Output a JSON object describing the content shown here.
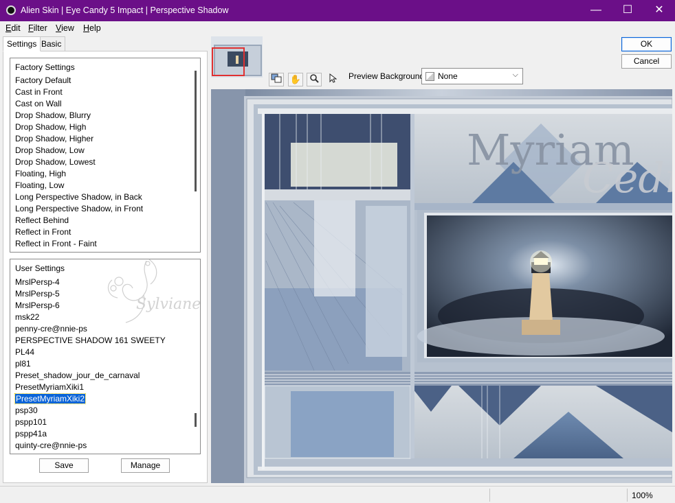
{
  "window": {
    "title": "Alien Skin | Eye Candy 5 Impact | Perspective Shadow",
    "controls": {
      "minimize": "—",
      "maximize": "☐",
      "close": "✕"
    }
  },
  "menu": [
    {
      "hot": "E",
      "rest": "dit"
    },
    {
      "hot": "F",
      "rest": "ilter"
    },
    {
      "hot": "V",
      "rest": "iew"
    },
    {
      "hot": "H",
      "rest": "elp"
    }
  ],
  "tabs": {
    "settings": "Settings",
    "basic": "Basic"
  },
  "factory": {
    "header": "Factory Settings",
    "items": [
      "Factory Default",
      "Cast in Front",
      "Cast on Wall",
      "Drop Shadow, Blurry",
      "Drop Shadow, High",
      "Drop Shadow, Higher",
      "Drop Shadow, Low",
      "Drop Shadow, Lowest",
      "Floating, High",
      "Floating, Low",
      "Long Perspective Shadow, in Back",
      "Long Perspective Shadow, in Front",
      "Reflect Behind",
      "Reflect in Front",
      "Reflect in Front - Faint"
    ]
  },
  "user": {
    "header": "User Settings",
    "items": [
      "MrslPersp-4",
      "MrslPersp-5",
      "MrslPersp-6",
      "msk22",
      "penny-cre@nnie-ps",
      "PERSPECTIVE SHADOW 161 SWEETY",
      "PL44",
      "pl81",
      "Preset_shadow_jour_de_carnaval",
      "PresetMyriamXiki1",
      "PresetMyriamXiki2",
      "psp30",
      "pspp101",
      "pspp41a",
      "quinty-cre@nnie-ps"
    ],
    "selected_index": 10,
    "watermark": "Sylviane"
  },
  "buttons": {
    "save": "Save",
    "manage": "Manage",
    "ok": "OK",
    "cancel": "Cancel"
  },
  "preview_background": {
    "label": "Preview Background:",
    "value": "None"
  },
  "preview_image": {
    "title_line1": "Myriam",
    "title_line2": "Cedro"
  },
  "status": {
    "zoom": "100%"
  }
}
